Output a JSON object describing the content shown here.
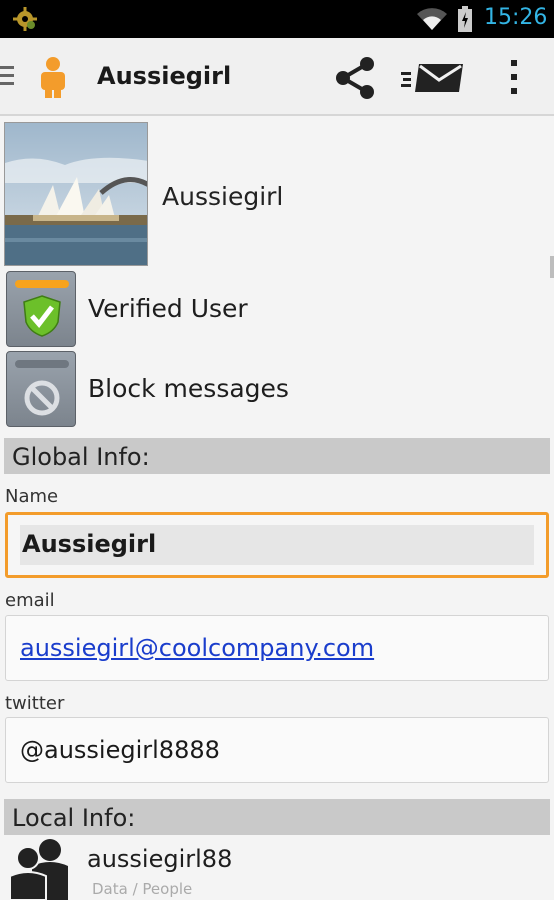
{
  "status_bar": {
    "time": "15:26",
    "icons": [
      "notification-gear-icon",
      "wifi-icon",
      "battery-icon"
    ],
    "time_color": "#33b5e5"
  },
  "action_bar": {
    "title": "Aussiegirl",
    "icons": [
      "drawer-menu-icon",
      "person-icon",
      "share-icon",
      "send-mail-icon",
      "overflow-menu-icon"
    ],
    "accent": "#f39c2b"
  },
  "profile": {
    "name": "Aussiegirl"
  },
  "badges": {
    "verified_label": "Verified User",
    "block_label": "Block messages",
    "verified_bar_color": "#f7a31d",
    "shield_color": "#6cc02a"
  },
  "global_info": {
    "header": "Global Info:",
    "name_label": "Name",
    "name_value": "Aussiegirl",
    "email_label": "email",
    "email_value": "aussiegirl@coolcompany.com",
    "twitter_label": "twitter",
    "twitter_value": "@aussiegirl8888"
  },
  "local_info": {
    "header": "Local Info:",
    "contact_name": "aussiegirl88",
    "contact_source": "Data / People"
  }
}
